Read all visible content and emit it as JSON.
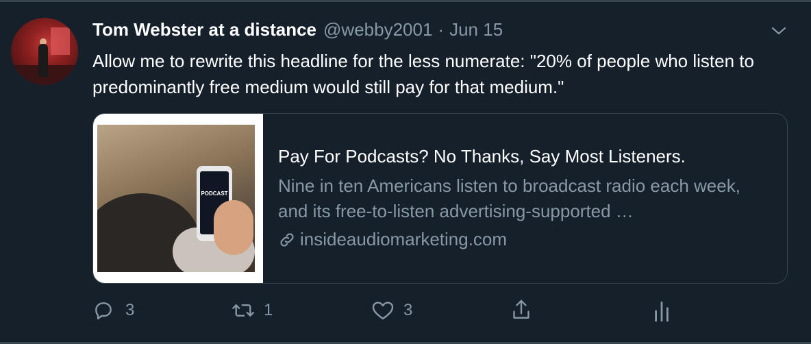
{
  "tweet": {
    "author_name": "Tom Webster at a distance",
    "author_handle": "@webby2001",
    "separator": "·",
    "date": "Jun 15",
    "text": "Allow me to rewrite this headline for the less numerate: \"20% of people who listen to predominantly free medium would still pay for that medium.\""
  },
  "card": {
    "image_label": "PODCAST",
    "title": "Pay For Podcasts? No Thanks, Say Most Listeners.",
    "description": "Nine in ten Americans listen to broadcast radio each week, and its free-to-listen advertising-supported …",
    "domain": "insideaudiomarketing.com"
  },
  "actions": {
    "reply_count": "3",
    "retweet_count": "1",
    "like_count": "3"
  },
  "icons": {
    "chevron": "chevron-down-icon",
    "reply": "reply-icon",
    "retweet": "retweet-icon",
    "like": "like-icon",
    "share": "share-icon",
    "analytics": "analytics-icon",
    "link": "link-icon"
  },
  "colors": {
    "background": "#15202b",
    "border": "#38444d",
    "secondary_text": "#8899a6",
    "primary_text": "#ffffff"
  }
}
